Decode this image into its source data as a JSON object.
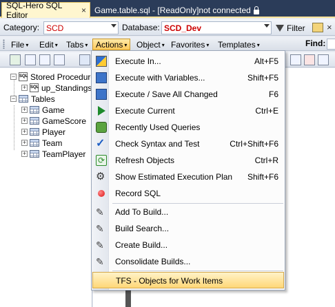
{
  "tabs": {
    "active_label": "SQL-Hero SQL Editor",
    "active_close": "×",
    "inactive_label": "Game.table.sql - [ReadOnly]not connected"
  },
  "catbar": {
    "category_label": "Category:",
    "category_value": "SCD",
    "database_label": "Database:",
    "database_value": "SCD_Dev",
    "filter_label": "Filter",
    "close_glyph": "×"
  },
  "menubar": {
    "items": [
      "File",
      "Edit",
      "Tabs",
      "Actions",
      "Object",
      "Favorites",
      "Templates"
    ],
    "caret": "▾",
    "find_label": "Find:"
  },
  "tree": {
    "stored_procedures": "Stored Procedure",
    "proc_item": "up_Standings",
    "tables": "Tables",
    "table_items": [
      "Game",
      "GameScore",
      "Player",
      "Team",
      "TeamPlayer"
    ],
    "expand": "+",
    "collapse": "−",
    "sql_glyph": "SQL"
  },
  "actions_menu": {
    "items": [
      {
        "label": "Execute In...",
        "shortcut": "Alt+F5",
        "icon": "execute-icon"
      },
      {
        "label": "Execute with Variables...",
        "shortcut": "Shift+F5",
        "icon": "execute-variables-icon"
      },
      {
        "label": "Execute / Save All Changed",
        "shortcut": "F6",
        "icon": "execute-save-icon"
      },
      {
        "label": "Execute Current",
        "shortcut": "Ctrl+E",
        "icon": "play-icon"
      },
      {
        "label": "Recently Used Queries",
        "shortcut": "",
        "icon": "recent-queries-icon"
      },
      {
        "label": "Check Syntax and Test",
        "shortcut": "Ctrl+Shift+F6",
        "icon": "check-syntax-icon"
      },
      {
        "label": "Refresh Objects",
        "shortcut": "Ctrl+R",
        "icon": "refresh-icon"
      },
      {
        "label": "Show Estimated Execution Plan",
        "shortcut": "Shift+F6",
        "icon": "execution-plan-icon"
      },
      {
        "label": "Record SQL",
        "shortcut": "",
        "icon": "record-icon"
      },
      {
        "label": "Add To Build...",
        "shortcut": "",
        "icon": "add-build-icon"
      },
      {
        "label": "Build Search...",
        "shortcut": "",
        "icon": "build-search-icon"
      },
      {
        "label": "Create Build...",
        "shortcut": "",
        "icon": "create-build-icon"
      },
      {
        "label": "Consolidate Builds...",
        "shortcut": "",
        "icon": "consolidate-builds-icon"
      },
      {
        "label": "TFS - Objects for Work Items",
        "shortcut": "",
        "icon": ""
      }
    ],
    "glyphs": {
      "check": "✓",
      "refresh": "⟳",
      "plan": "⚙",
      "tool": "✎"
    }
  },
  "colors": {
    "tabstrip": "#2b3c59",
    "accent_highlight": "#ffd777",
    "value_red": "#cc0000"
  }
}
